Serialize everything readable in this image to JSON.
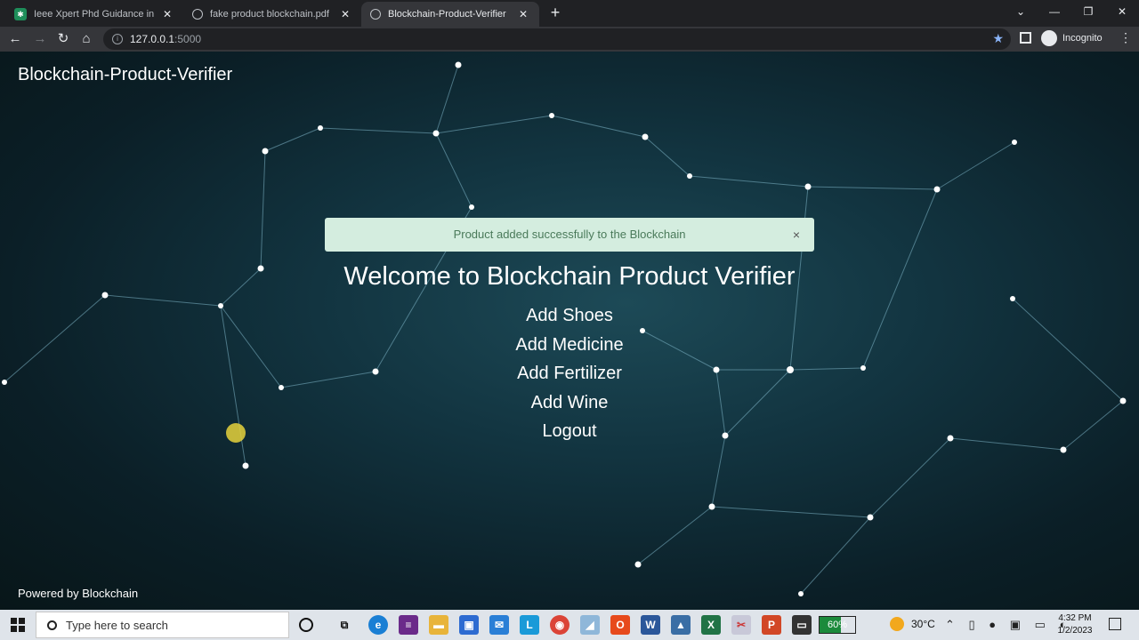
{
  "browser": {
    "tabs": [
      {
        "title": "Ieee Xpert Phd Guidance in Chen",
        "favicon": "site-icon"
      },
      {
        "title": "fake product blockchain.pdf",
        "favicon": "globe-icon"
      },
      {
        "title": "Blockchain-Product-Verifier",
        "favicon": "globe-icon"
      }
    ],
    "close_glyph": "✕",
    "new_tab_glyph": "+",
    "url_host": "127.0.0.1",
    "url_port": ":5000",
    "profile_label": "Incognito"
  },
  "page": {
    "brand": "Blockchain-Product-Verifier",
    "alert_message": "Product added successfully to the Blockchain",
    "alert_close": "×",
    "welcome": "Welcome to Blockchain Product Verifier",
    "menu": [
      {
        "label": "Add Shoes"
      },
      {
        "label": "Add Medicine"
      },
      {
        "label": "Add Fertilizer"
      },
      {
        "label": "Add Wine"
      },
      {
        "label": "Logout"
      }
    ],
    "footer": "Powered by Blockchain"
  },
  "taskbar": {
    "search_placeholder": "Type here to search",
    "battery": "60%",
    "battery_level": 0.6,
    "temperature": "30°C",
    "time": "4:32 PM",
    "date": "1/2/2023"
  },
  "colors": {
    "alert_bg": "#d4eddf",
    "accent": "#8ab4f8"
  }
}
